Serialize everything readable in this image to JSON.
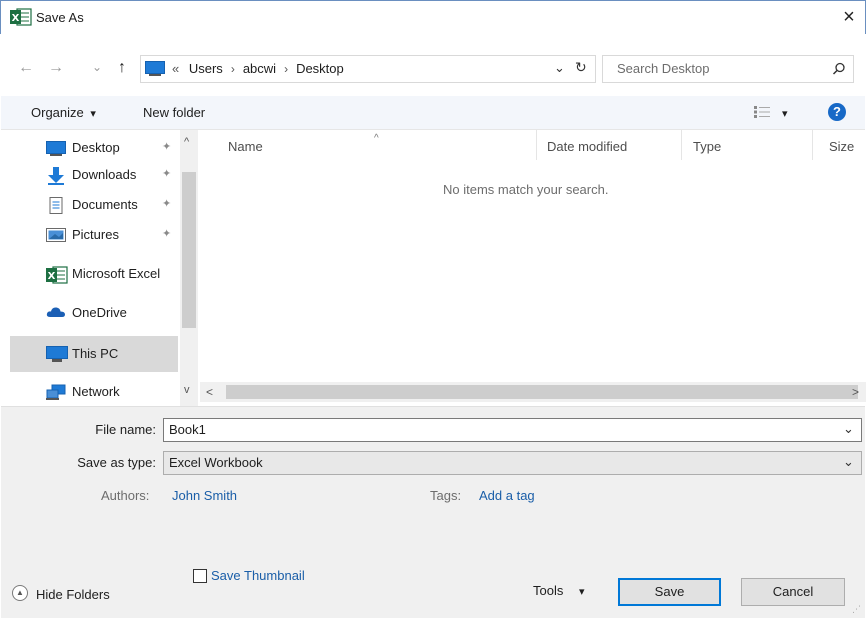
{
  "window": {
    "title": "Save As",
    "close_glyph": "×",
    "icon": "excel-icon"
  },
  "nav_buttons": {
    "back": "←",
    "forward": "→",
    "recent": "⌄",
    "up": "↑"
  },
  "address": {
    "overflow": "«",
    "crumbs": [
      "Users",
      "abcwi",
      "Desktop"
    ],
    "separator": "›",
    "dropdown_glyph": "⌄",
    "refresh_glyph": "↻"
  },
  "search": {
    "placeholder": "Search Desktop",
    "icon": "search-icon"
  },
  "toolbar": {
    "organize_label": "Organize",
    "organize_arrow": "▾",
    "new_folder_label": "New folder",
    "view_arrow": "▾",
    "help_glyph": "?"
  },
  "sidebar": {
    "items": [
      {
        "label": "Desktop",
        "icon": "desktop-icon",
        "pinned": true,
        "pin_glyph": "✦"
      },
      {
        "label": "Downloads",
        "icon": "downloads-icon",
        "pinned": true,
        "pin_glyph": "✦"
      },
      {
        "label": "Documents",
        "icon": "documents-icon",
        "pinned": true,
        "pin_glyph": "✦"
      },
      {
        "label": "Pictures",
        "icon": "pictures-icon",
        "pinned": true,
        "pin_glyph": "✦"
      },
      {
        "label": "Microsoft Excel",
        "icon": "excel-icon"
      },
      {
        "label": "OneDrive",
        "icon": "onedrive-icon"
      },
      {
        "label": "This PC",
        "icon": "this-pc-icon",
        "selected": true
      },
      {
        "label": "Network",
        "icon": "network-icon"
      }
    ],
    "scroll_up": "^",
    "scroll_down": "v"
  },
  "file_list": {
    "columns": [
      "Name",
      "Date modified",
      "Type",
      "Size"
    ],
    "sort_glyph": "^",
    "empty_message": "No items match your search.",
    "scroll_left": "<",
    "scroll_right": ">"
  },
  "form": {
    "file_name_label": "File name:",
    "file_name_value": "Book1",
    "save_as_type_label": "Save as type:",
    "save_as_type_value": "Excel Workbook",
    "dropdown_glyph": "⌄",
    "authors_label": "Authors:",
    "authors_value": "John Smith",
    "tags_label": "Tags:",
    "tags_value": "Add a tag",
    "thumbnail_label": "Save Thumbnail",
    "thumbnail_checked": false
  },
  "footer": {
    "hide_folders_label": "Hide Folders",
    "hide_folders_glyph": "▲",
    "tools_label": "Tools",
    "tools_arrow": "▾",
    "save_label": "Save",
    "cancel_label": "Cancel"
  },
  "colors": {
    "excel_green": "#1d6f42",
    "link_blue": "#1a5ea8",
    "folder_blue": "#1e7ad6",
    "help_blue": "#1769c7",
    "selected_bg": "#d9d9d9",
    "bottom_bg": "#f0f0f0"
  }
}
